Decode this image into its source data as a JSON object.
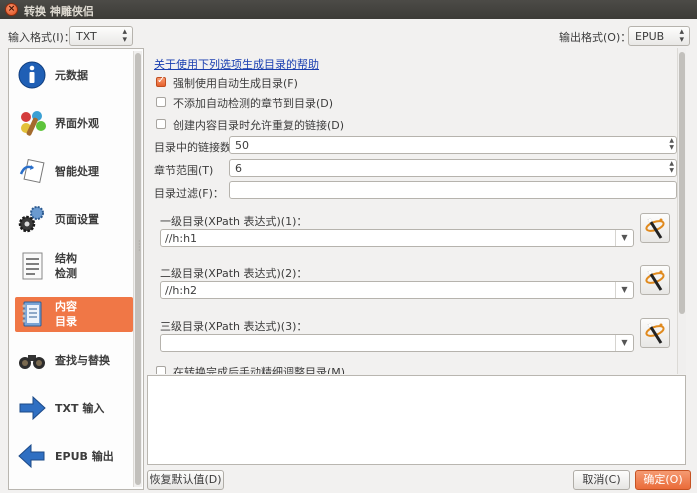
{
  "window": {
    "title": "转换 神雕侠侣",
    "close_glyph": "×"
  },
  "toolbar": {
    "input_format_label": "输入格式(I)：",
    "input_format_value": "TXT",
    "output_format_label": "输出格式(O)：",
    "output_format_value": "EPUB"
  },
  "sidebar": {
    "items": [
      {
        "label": "元数据",
        "icon": "info-icon",
        "active": false
      },
      {
        "label": "界面外观",
        "icon": "look-feel-icon",
        "active": false
      },
      {
        "label": "智能处理",
        "icon": "heuristics-icon",
        "active": false
      },
      {
        "label": "页面设置",
        "icon": "page-setup-icon",
        "active": false
      },
      {
        "label": "结构\n检测",
        "icon": "structure-icon",
        "active": false
      },
      {
        "label": "内容\n目录",
        "icon": "toc-icon",
        "active": true
      },
      {
        "label": "查找与替换",
        "icon": "binoculars-icon",
        "active": false
      },
      {
        "label": "TXT 输入",
        "icon": "arrow-right-icon",
        "active": false
      },
      {
        "label": "EPUB 输出",
        "icon": "arrow-left-icon",
        "active": false
      }
    ]
  },
  "toc": {
    "help_link": "关于使用下列选项生成目录的帮助",
    "force_auto_toc": {
      "label": "强制使用自动生成目录(F)",
      "checked": true
    },
    "no_chapters_in_toc": {
      "label": "不添加自动检测的章节到目录(D)",
      "checked": false
    },
    "allow_duplicate_links": {
      "label": "创建内容目录时允许重复的链接(D)",
      "checked": false
    },
    "max_links": {
      "label": "目录中的链接数",
      "value": "50"
    },
    "chapter_threshold": {
      "label": "章节范围(T)",
      "value": "6"
    },
    "toc_filter": {
      "label": "目录过滤(F)：",
      "value": ""
    },
    "level1": {
      "label": "一级目录(XPath 表达式)(1)：",
      "value": "//h:h1"
    },
    "level2": {
      "label": "二级目录(XPath 表达式)(2)：",
      "value": "//h:h2"
    },
    "level3": {
      "label": "三级目录(XPath 表达式)(3)：",
      "value": ""
    },
    "manual_fine_tune": {
      "label": "在转换完成后手动精细调整目录(M)",
      "checked": false
    }
  },
  "footer": {
    "restore_defaults": "恢复默认值(D)",
    "cancel": "取消(C)",
    "ok": "确定(O)"
  },
  "colors": {
    "accent": "#f07746",
    "link": "#1a3fb0",
    "titlebar": "#3c3b37"
  }
}
